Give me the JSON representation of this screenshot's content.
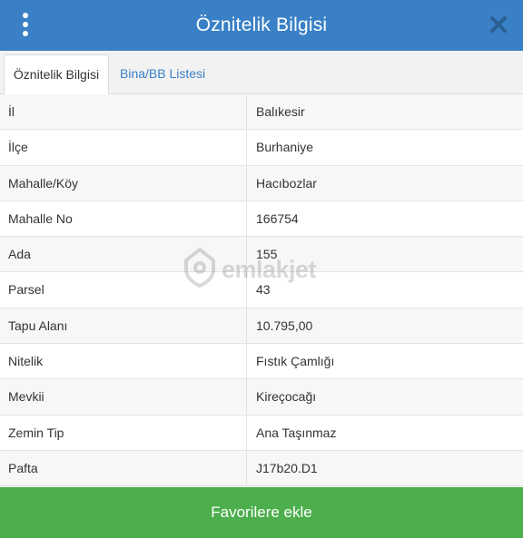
{
  "header": {
    "title": "Öznitelik Bilgisi",
    "menu_icon": "vertical-dots-icon",
    "close_icon": "close-x-icon",
    "color": "#3a80c6"
  },
  "tabs": [
    {
      "label": "Öznitelik Bilgisi",
      "active": true
    },
    {
      "label": "Bina/BB Listesi",
      "active": false
    }
  ],
  "attributes": [
    {
      "key": "İl",
      "value": "Balıkesir"
    },
    {
      "key": "İlçe",
      "value": "Burhaniye"
    },
    {
      "key": "Mahalle/Köy",
      "value": "Hacıbozlar"
    },
    {
      "key": "Mahalle No",
      "value": "166754"
    },
    {
      "key": "Ada",
      "value": "155"
    },
    {
      "key": "Parsel",
      "value": "43"
    },
    {
      "key": "Tapu Alanı",
      "value": "10.795,00"
    },
    {
      "key": "Nitelik",
      "value": "Fıstık Çamlığı"
    },
    {
      "key": "Mevkii",
      "value": "Kireçocağı"
    },
    {
      "key": "Zemin Tip",
      "value": "Ana Taşınmaz"
    },
    {
      "key": "Pafta",
      "value": "J17b20.D1"
    }
  ],
  "watermark": {
    "text": "emlakjet",
    "icon": "house-pin-icon"
  },
  "footer": {
    "button_label": "Favorilere ekle",
    "color": "#4cae4c"
  }
}
